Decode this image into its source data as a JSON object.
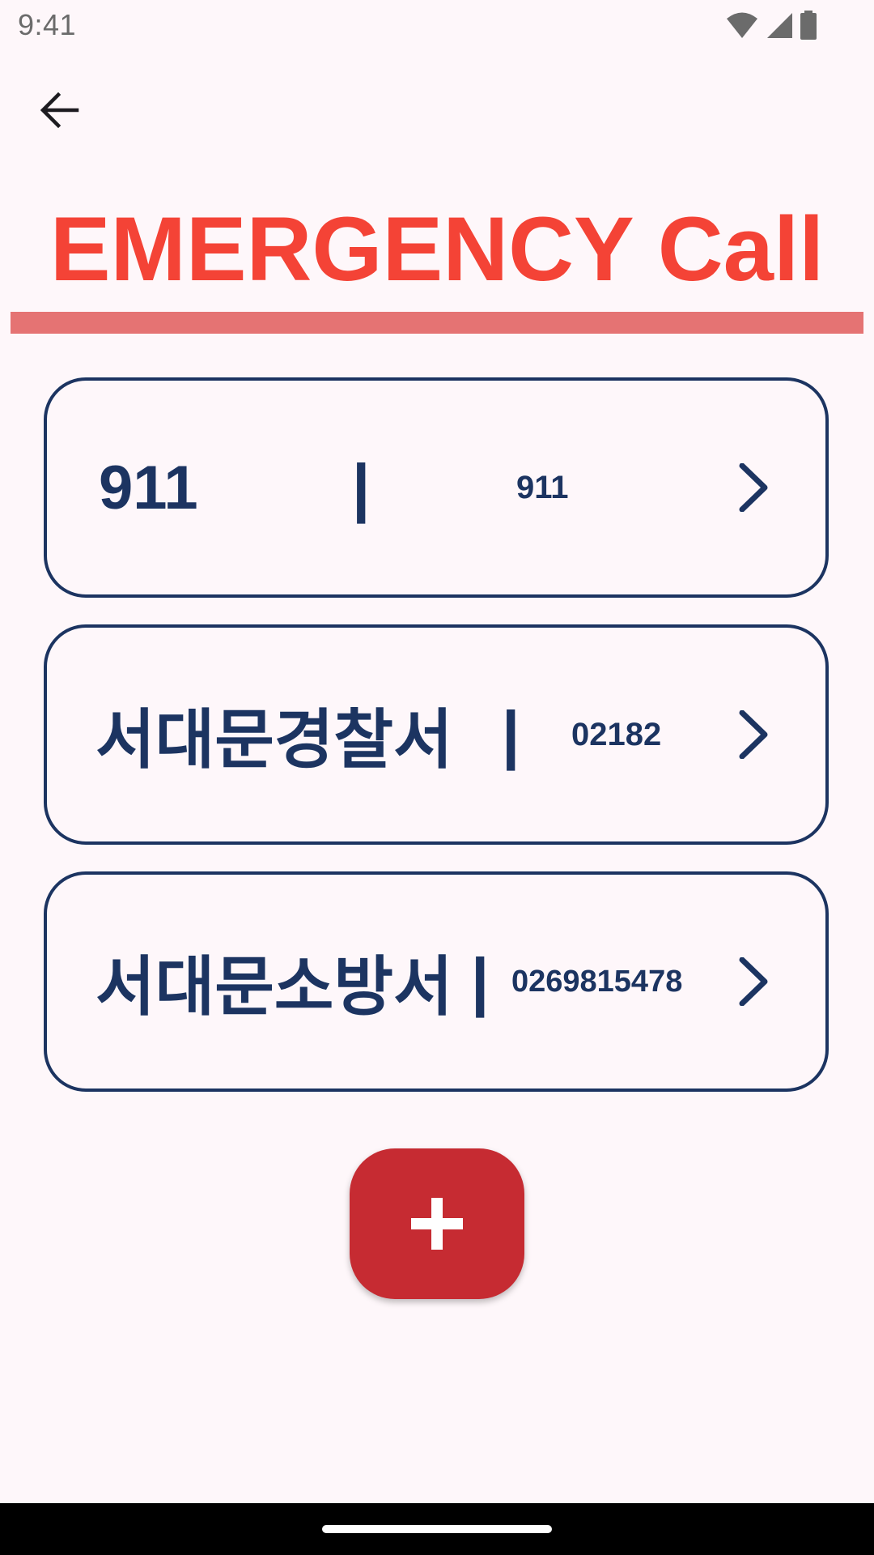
{
  "status_bar": {
    "time": "9:41",
    "icons": [
      "wifi-icon",
      "cell-signal-icon",
      "battery-icon"
    ]
  },
  "app_bar": {
    "back_icon": "arrow-back-icon"
  },
  "title": "EMERGENCY Call",
  "contacts": [
    {
      "name": "911",
      "separator": "|",
      "number": "911"
    },
    {
      "name": "서대문경찰서",
      "separator": "|",
      "number": "02182"
    },
    {
      "name": "서대문소방서",
      "separator": "|",
      "number": "0269815478"
    }
  ],
  "fab": {
    "icon": "plus-icon"
  },
  "colors": {
    "background": "#FEF7FA",
    "title_red": "#F44336",
    "divider": "#E57373",
    "card_navy": "#1C3461",
    "fab_red": "#C62B32"
  }
}
